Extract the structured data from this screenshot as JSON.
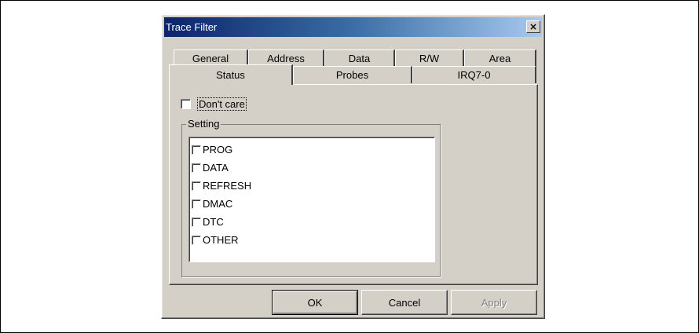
{
  "dialog": {
    "title": "Trace Filter",
    "close_glyph": "×"
  },
  "tabs": {
    "row1": [
      "General",
      "Address",
      "Data",
      "R/W",
      "Area"
    ],
    "row2": [
      "Status",
      "Probes",
      "IRQ7-0"
    ],
    "selected": "Status"
  },
  "status_tab": {
    "dont_care_label": "Don't care",
    "dont_care_checked": false,
    "group_label": "Setting",
    "items": [
      {
        "label": "PROG",
        "checked": false
      },
      {
        "label": "DATA",
        "checked": false
      },
      {
        "label": "REFRESH",
        "checked": false
      },
      {
        "label": "DMAC",
        "checked": false
      },
      {
        "label": "DTC",
        "checked": false
      },
      {
        "label": "OTHER",
        "checked": false
      }
    ]
  },
  "buttons": {
    "ok": "OK",
    "cancel": "Cancel",
    "apply": "Apply",
    "apply_enabled": false
  }
}
